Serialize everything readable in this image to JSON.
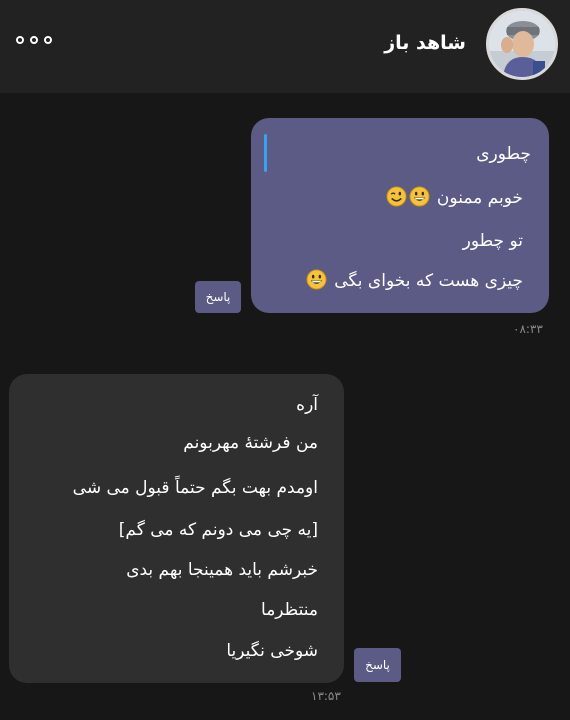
{
  "header": {
    "contact_name": "شاهد باز",
    "more_icon": "more-dots-icon",
    "avatar_icon": "avatar-photo"
  },
  "outgoing": {
    "quoted_text": "چطوری",
    "lines": [
      "خوبم ممنون",
      "تو چطور",
      "چیزی هست که بخوای بگی"
    ],
    "emojis": [
      "grinning-face",
      "winking-face",
      "grinning-face"
    ],
    "reply_label": "پاسخ",
    "time": "۰۸:۳۳"
  },
  "incoming": {
    "lines": [
      "آره",
      "من فرشتۀ مهربونم",
      "اومدم بهت بگم حتماً قبول می شی",
      "[یه چی می دونم که می گم]",
      "خبرشم باید همینجا بهم بدی",
      "منتظرما",
      "شوخی نگیریا"
    ],
    "reply_label": "پاسخ",
    "time": "۱۳:۵۳"
  },
  "colors": {
    "background": "#171717",
    "header": "#222222",
    "outgoing_bubble": "#5b5b85",
    "incoming_bubble": "#2f2f2f",
    "quote_bar": "#3aa0f0"
  }
}
